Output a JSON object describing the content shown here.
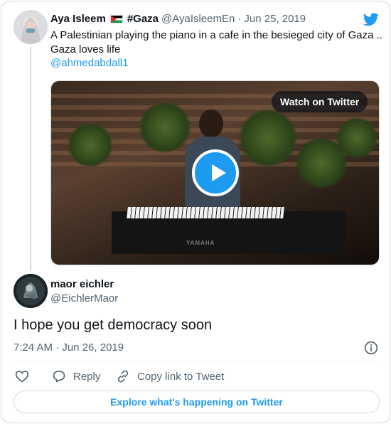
{
  "original_tweet": {
    "author_name": "Aya Isleem",
    "author_hashtag": "#Gaza",
    "author_handle": "@AyaIsleemEn",
    "separator": "·",
    "date": "Jun 25, 2019",
    "text": "A Palestinian playing the piano in a cafe in the besieged city of Gaza .. Gaza loves life",
    "mention": "@ahmedabdall1",
    "media": {
      "watch_label": "Watch on Twitter",
      "keyboard_brand": "YAMAHA"
    }
  },
  "reply_tweet": {
    "author_name": "maor eichler",
    "author_handle": "@EichlerMaor",
    "text": "I hope you get democracy soon",
    "timestamp": "7:24 AM · Jun 26, 2019"
  },
  "actions": {
    "reply_label": "Reply",
    "copy_link_label": "Copy link to Tweet"
  },
  "footer": {
    "explore_label": "Explore what's happening on Twitter"
  },
  "colors": {
    "accent": "#1d9bf0",
    "text": "#0f1419",
    "muted": "#536471",
    "border": "#cfd9de"
  },
  "icons": [
    "twitter-bird-icon",
    "flag-palestine-icon",
    "play-icon",
    "info-icon",
    "heart-icon",
    "reply-icon",
    "copy-link-icon"
  ]
}
